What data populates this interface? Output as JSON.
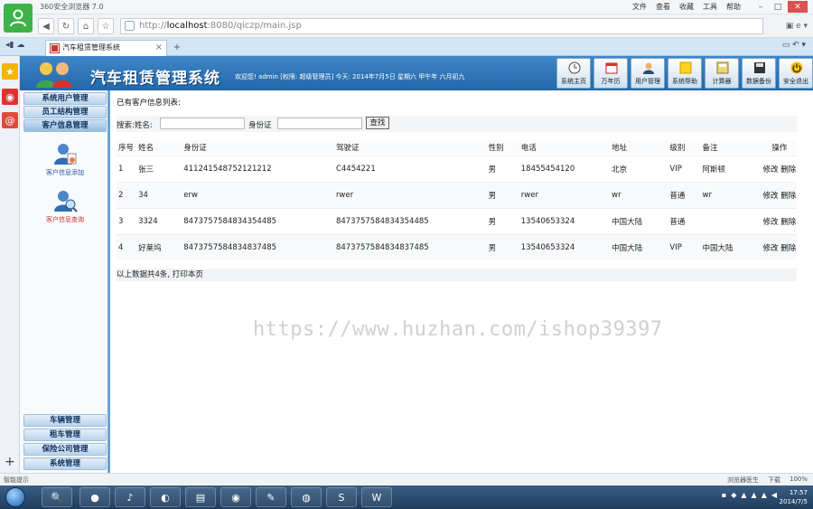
{
  "browser": {
    "title": "360安全浏览器 7.0",
    "menus": [
      "文件",
      "查看",
      "收藏",
      "工具",
      "帮助"
    ],
    "url_prefix": "http://",
    "url_host": "localhost",
    "url_rest": ":8080/qiczp/main.jsp",
    "tab_title": "汽车租赁管理系统"
  },
  "app": {
    "title": "汽车租赁管理系统",
    "welcome": "欢迎您! admin [权限: 超级管理员] 今天: 2014年7月5日 星期六 甲午年 六月初九",
    "toolbar": [
      {
        "label": "系统主页",
        "icon": "clock-icon"
      },
      {
        "label": "万年历",
        "icon": "calendar-icon"
      },
      {
        "label": "用户管理",
        "icon": "user-icon"
      },
      {
        "label": "系统帮助",
        "icon": "note-icon"
      },
      {
        "label": "计算器",
        "icon": "calculator-icon"
      },
      {
        "label": "数据备份",
        "icon": "disk-icon"
      },
      {
        "label": "安全退出",
        "icon": "power-icon"
      }
    ]
  },
  "nav": {
    "top": [
      "系统用户管理",
      "员工结构管理",
      "客户信息管理"
    ],
    "sub": [
      "客户信息添加",
      "客户信息查询"
    ],
    "bottom": [
      "车辆管理",
      "租车管理",
      "保险公司管理",
      "系统管理"
    ]
  },
  "main": {
    "list_title": "已有客户信息列表:",
    "search_label_name": "搜索:姓名:",
    "search_label_id": "身份证",
    "search_button": "查找",
    "columns": [
      "序号",
      "姓名",
      "身份证",
      "驾驶证",
      "性别",
      "电话",
      "地址",
      "级别",
      "备注",
      "操作"
    ],
    "rows": [
      [
        "1",
        "张三",
        "411241548752121212",
        "C4454221",
        "男",
        "18455454120",
        "北京",
        "VIP",
        "阿斯顿"
      ],
      [
        "2",
        "34",
        "erw",
        "rwer",
        "男",
        "rwer",
        "wr",
        "普通",
        "wr"
      ],
      [
        "3",
        "3324",
        "847375758483435448​5",
        "847375758483435448​5",
        "男",
        "13540653324",
        "中国大陆",
        "普通",
        ""
      ],
      [
        "4",
        "好莱坞",
        "8473757584834837485",
        "8473757584834837485",
        "男",
        "13540653324",
        "中国大陆",
        "VIP",
        "中国大陆"
      ]
    ],
    "op_edit": "修改",
    "op_delete": "删除",
    "footer": "以上数据共4条, 打印本页"
  },
  "watermark": "https://www.huzhan.com/ishop39397",
  "statusbar": {
    "left": "智能提示",
    "items": [
      "浏览器医生",
      "下载",
      "100%"
    ]
  },
  "taskbar": {
    "time": "17:57",
    "date": "2014/7/5"
  }
}
